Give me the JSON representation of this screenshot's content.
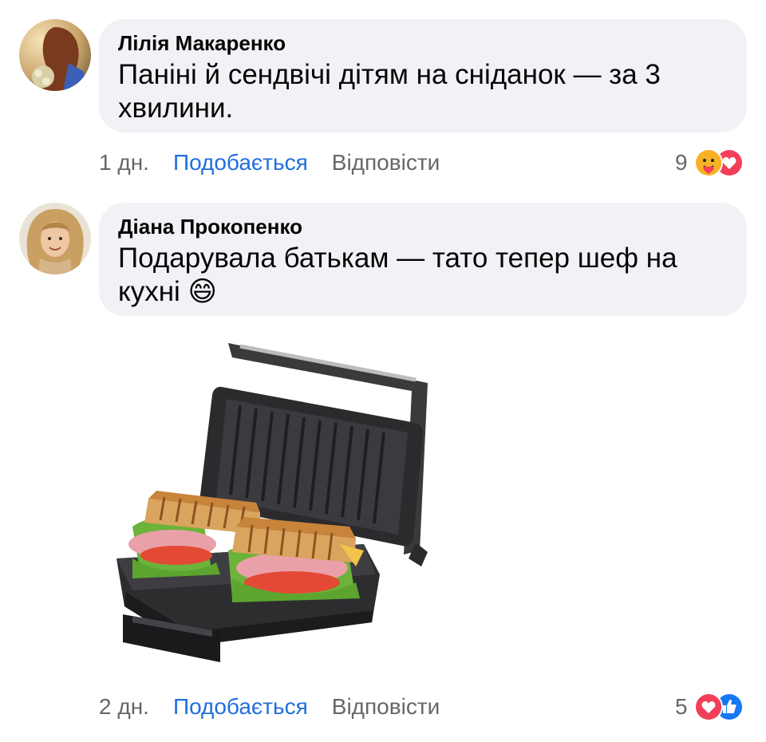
{
  "comments": [
    {
      "author": "Лілія Макаренко",
      "text": "Паніні й сендвічі дітям на сніданок — за 3 хвилини.",
      "time": "1 дн.",
      "like_label": "Подобається",
      "reply_label": "Відповісти",
      "reaction_count": "9",
      "reactions": [
        "care-icon",
        "love-icon"
      ]
    },
    {
      "author": "Діана Прокопенко",
      "text": "Подарувала батькам — тато тепер шеф на кухні 😄",
      "time": "2 дн.",
      "like_label": "Подобається",
      "reply_label": "Відповісти",
      "reaction_count": "5",
      "reactions": [
        "love-icon",
        "like-icon"
      ],
      "attachment": "panini-grill-with-sandwiches-photo"
    }
  ],
  "colors": {
    "bubble": "#f0f2f5",
    "link": "#216fdb",
    "muted": "#65676b",
    "love": "#f33e58",
    "like": "#1877f2",
    "care": "#f7b125"
  }
}
